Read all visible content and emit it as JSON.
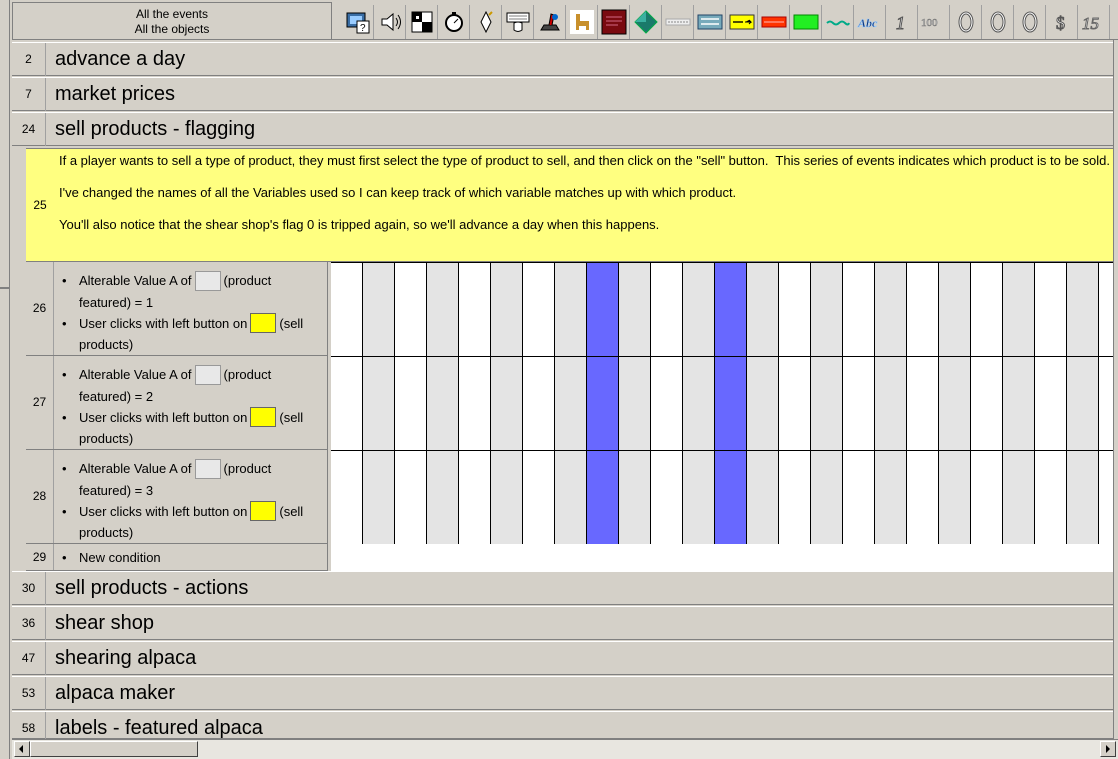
{
  "header": {
    "line1": "All the events",
    "line2": "All the objects",
    "object_icons": [
      "system-icon",
      "sound-icon",
      "storyboard-icon",
      "timer-icon",
      "create-object-icon",
      "keyboard-mouse-icon",
      "player-icon",
      "alpaca-icon",
      "shop-picture-icon",
      "diamond-icon",
      "counter-icon",
      "pass-month-button-icon",
      "sell-button-icon",
      "red-button-icon",
      "green-button-icon",
      "string-icon",
      "text-abc-icon",
      "number-1-icon",
      "number-100-icon",
      "counter-zero-icon",
      "counter-zero-icon",
      "counter-zero-icon",
      "dollar-icon",
      "number-15-icon"
    ]
  },
  "groups": {
    "advance": {
      "num": "2",
      "label": "advance a day"
    },
    "market": {
      "num": "7",
      "label": "market prices"
    },
    "sell_flag": {
      "num": "24",
      "label": "sell products - flagging"
    },
    "sell_actions": {
      "num": "30",
      "label": "sell products - actions"
    },
    "shear_shop": {
      "num": "36",
      "label": "shear shop"
    },
    "shearing": {
      "num": "47",
      "label": "shearing alpaca"
    },
    "maker": {
      "num": "53",
      "label": "alpaca maker"
    },
    "labels": {
      "num": "58",
      "label": "labels - featured alpaca"
    }
  },
  "comment": {
    "num": "25",
    "text": "If a player wants to sell a type of product, they must first select the type of product to sell, and then click on the \"sell\" button.  This series of events indicates which product is to be sold.\n\nI've changed the names of all the Variables used so I can keep track of which variable matches up with which product.\n\nYou'll also notice that the shear shop's flag 0 is tripped again, so we'll advance a day when this happens."
  },
  "events": [
    {
      "num": "26",
      "c1_pre": "Alterable Value A of",
      "c1_post": "(product featured) = 1",
      "c2_pre": "User clicks with left button on",
      "c2_post": "(sell products)"
    },
    {
      "num": "27",
      "c1_pre": "Alterable Value A of",
      "c1_post": "(product featured) = 2",
      "c2_pre": "User clicks with left button on",
      "c2_post": "(sell products)"
    },
    {
      "num": "28",
      "c1_pre": "Alterable Value A of",
      "c1_post": "(product featured) = 3",
      "c2_pre": "User clicks with left button on",
      "c2_post": "(sell products)"
    }
  ],
  "new_condition": {
    "num": "29",
    "label": "New condition"
  },
  "colors": {
    "comment_bg": "#ffff80",
    "action_marker": "#6868ff",
    "grid_gray": "#e4e4e4"
  }
}
